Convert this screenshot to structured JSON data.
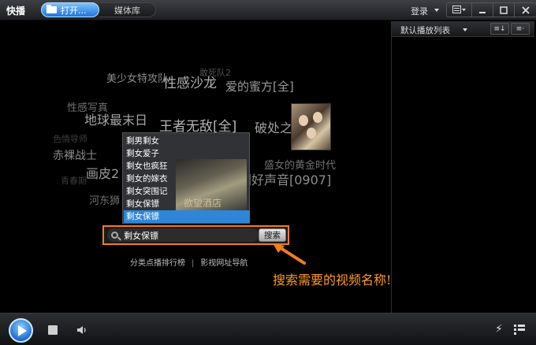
{
  "titlebar": {
    "app_title": "快播",
    "tab_open": "打开...",
    "tab_media": "媒体库",
    "login": "登录",
    "icons": [
      "folder-icon",
      "playlist-toggle-icon",
      "minimize-icon",
      "maximize-icon",
      "close-icon"
    ]
  },
  "tag_cloud": [
    {
      "text": "美少女特攻队",
      "color": "#8d8d8d",
      "size": 13
    },
    {
      "text": "敢死队2",
      "color": "#505050",
      "size": 11
    },
    {
      "text": "性感沙龙",
      "color": "#b0b0b0",
      "size": 17
    },
    {
      "text": "爱的蜜方[全]",
      "color": "#9a9a9a",
      "size": 15
    },
    {
      "text": "性感写真",
      "color": "#707070",
      "size": 13
    },
    {
      "text": "地球最末日",
      "color": "#a5a5a5",
      "size": 16
    },
    {
      "text": "王者无敌[全]",
      "color": "#b5b5b5",
      "size": 17
    },
    {
      "text": "破处之战",
      "color": "#a0a0a0",
      "size": 16
    },
    {
      "text": "色情导师",
      "color": "#3c3c3c",
      "size": 11
    },
    {
      "text": "赤裸战士",
      "color": "#8a8a8a",
      "size": 14
    },
    {
      "text": "画皮2",
      "color": "#9a9a9a",
      "size": 16
    },
    {
      "text": "青春期",
      "color": "#3c3c3c",
      "size": 11
    },
    {
      "text": "盛女的黄金时代",
      "color": "#6e6e6e",
      "size": 13
    },
    {
      "text": "中国好声音[0907]",
      "color": "#8c8c8c",
      "size": 16
    },
    {
      "text": "河东狮",
      "color": "#707070",
      "size": 13
    }
  ],
  "dropdown": {
    "items": [
      "剩男剩女",
      "剩女爱子",
      "剩女也疯狂",
      "剩女的嫁衣",
      "剩女突围记",
      "剩女保镖",
      "剩女保镖"
    ],
    "selected_index": 6,
    "poster_text": "欲望酒店"
  },
  "search": {
    "value": "剩女保镖",
    "button_label": "搜索"
  },
  "links": {
    "ranking": "分类点播排行榜",
    "separator": "|",
    "navigation": "影视网址导航"
  },
  "annotation": "搜索需要的视频名称!",
  "playlist": {
    "title": "默认播放列表",
    "btn1": "≡↓",
    "btn2": "≡·"
  },
  "colors": {
    "accent_orange": "#f07e1a",
    "selection_blue": "#2f86d8",
    "tab_blue": "#1f76d9"
  }
}
